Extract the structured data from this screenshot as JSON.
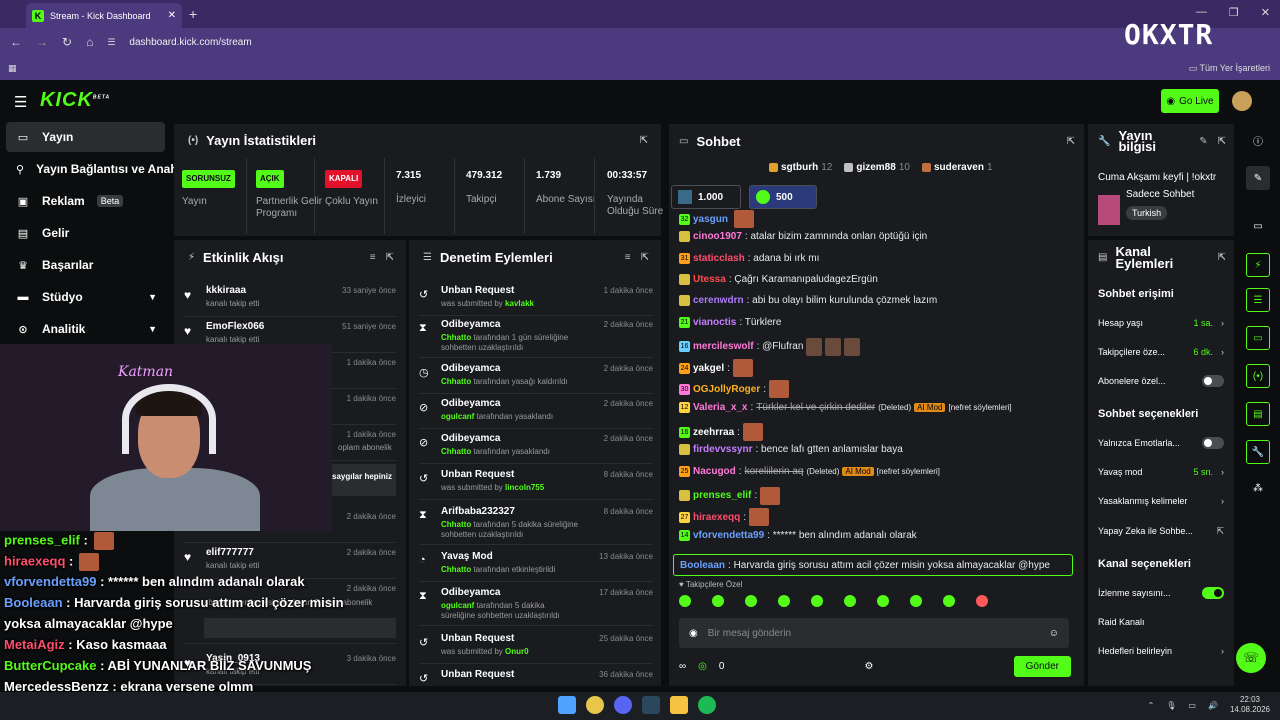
{
  "browser": {
    "tab_title": "Stream - Kick Dashboard",
    "url": "dashboard.kick.com/stream",
    "all_bookmarks": "Tüm Yer İşaretleri",
    "watermark": "OKXTR"
  },
  "header": {
    "logo": "KICK",
    "logo_beta": "BETA",
    "go_live": "Go Live"
  },
  "sidebar": {
    "items": [
      {
        "label": "Yayın",
        "icon": "broadcast-icon"
      },
      {
        "label": "Yayın Bağlantısı ve Anahtar",
        "icon": "link-icon"
      },
      {
        "label": "Reklam",
        "icon": "ad-icon",
        "badge": "Beta"
      },
      {
        "label": "Gelir",
        "icon": "revenue-icon"
      },
      {
        "label": "Başarılar",
        "icon": "trophy-icon"
      },
      {
        "label": "Stüdyo",
        "icon": "studio-icon"
      },
      {
        "label": "Analitik",
        "icon": "analytics-icon"
      }
    ]
  },
  "stats": {
    "title": "Yayın İstatistikleri",
    "cols": [
      {
        "badge": "SORUNSUZ",
        "label": "Yayın"
      },
      {
        "badge": "AÇIK",
        "label": "Partnerlik Gelir Programı"
      },
      {
        "badge": "KAPALI",
        "label": "Çoklu Yayın"
      },
      {
        "value": "7.315",
        "label": "İzleyici"
      },
      {
        "value": "479.312",
        "label": "Takipçi"
      },
      {
        "value": "1.739",
        "label": "Abone Sayısı"
      },
      {
        "value": "00:33:57",
        "label": "Yayında Olduğu Süre"
      }
    ]
  },
  "activity": {
    "title": "Etkinlik Akışı",
    "rows": [
      {
        "name": "kkkiraaa",
        "sub": "kanalı takip etti",
        "time": "33 saniye önce"
      },
      {
        "name": "EmoFlex066",
        "sub": "kanalı takip etti",
        "time": "51 saniye önce"
      },
      {
        "name": "",
        "sub": "",
        "time": "1 dakika önce"
      },
      {
        "name": "",
        "sub": "",
        "time": "1 dakika önce"
      },
      {
        "name": "",
        "sub": "oplam abonelik",
        "time": "1 dakika önce"
      },
      {
        "name": "saygılar hepiniz",
        "sub": "",
        "time": ""
      },
      {
        "name": "",
        "sub": "",
        "time": "2 dakika önce"
      },
      {
        "name": "elif777777",
        "sub": "kanalı takip etti",
        "time": "2 dakika önce"
      },
      {
        "name": "",
        "sub": "abonelik yenilemesini kutluyor! Toplam abonelik",
        "time": "2 dakika önce"
      },
      {
        "name": "Yasin_0913",
        "sub": "kanalı takip etti",
        "time": "3 dakika önce"
      }
    ]
  },
  "moderation": {
    "title": "Denetim Eylemleri",
    "rows": [
      {
        "icon": "history-icon",
        "name": "Unban Request",
        "pre": "was submitted by",
        "user": "kavlakk",
        "post": "",
        "time": "1 dakika önce"
      },
      {
        "icon": "hourglass-icon",
        "name": "Odibeyamca",
        "pre": "",
        "user": "Chhatto",
        "post": "tarafından 1 gün süreliğine sohbetten uzaklaştırıldı",
        "time": "2 dakika önce"
      },
      {
        "icon": "clock-icon",
        "name": "Odibeyamca",
        "pre": "",
        "user": "Chhatto",
        "post": "tarafından yasağı kaldırıldı",
        "time": "2 dakika önce"
      },
      {
        "icon": "ban-icon",
        "name": "Odibeyamca",
        "pre": "",
        "user": "ogulcanf",
        "post": "tarafından yasaklandı",
        "time": "2 dakika önce"
      },
      {
        "icon": "ban-icon",
        "name": "Odibeyamca",
        "pre": "",
        "user": "Chhatto",
        "post": "tarafından yasaklandı",
        "time": "2 dakika önce"
      },
      {
        "icon": "history-icon",
        "name": "Unban Request",
        "pre": "was submitted by",
        "user": "lincoln755",
        "post": "",
        "time": "8 dakika önce"
      },
      {
        "icon": "hourglass-icon",
        "name": "Arifbaba232327",
        "pre": "",
        "user": "Chhatto",
        "post": "tarafından 5 dakika süreliğine sohbetten uzaklaştırıldı",
        "time": "8 dakika önce"
      },
      {
        "icon": "slow-mode-icon",
        "name": "Yavaş Mod",
        "pre": "",
        "user": "Chhatto",
        "post": "tarafından etkinleştirildi",
        "time": "13 dakika önce"
      },
      {
        "icon": "hourglass-icon",
        "name": "Odibeyamca",
        "pre": "",
        "user": "ogulcanf",
        "post": "tarafından 5 dakika süreliğine sohbetten uzaklaştırıldı",
        "time": "17 dakika önce"
      },
      {
        "icon": "history-icon",
        "name": "Unban Request",
        "pre": "was submitted by",
        "user": "Onur0",
        "post": "",
        "time": "25 dakika önce"
      },
      {
        "icon": "history-icon",
        "name": "Unban Request",
        "pre": "",
        "user": "",
        "post": "",
        "time": "36 dakika önce"
      }
    ]
  },
  "chat": {
    "title": "Sohbet",
    "gifters": [
      {
        "name": "sgtburh",
        "count": "12",
        "color": "#e0a030"
      },
      {
        "name": "gizem88",
        "count": "10",
        "color": "#c0c0c0"
      },
      {
        "name": "suderaven",
        "count": "1",
        "color": "#c07040"
      }
    ],
    "pills": [
      "1.000",
      "500"
    ],
    "messages": [
      {
        "badge": "32",
        "user": "yasgun",
        "ucolor": "#6aa0ff",
        "text": "",
        "emote": true
      },
      {
        "badge": "",
        "user": "cinoo1907",
        "ucolor": "#ff7ad9",
        "text": ": atalar bizim zamnında onları öptüğü için"
      },
      {
        "badge": "31",
        "user": "staticclash",
        "ucolor": "#ff4d6d",
        "text": ": adana bi ırk mı"
      },
      {
        "badge": "",
        "user": "Utessa",
        "ucolor": "#ff4d4d",
        "text": ": Çağrı KaramanıpaludagezErgün"
      },
      {
        "badge": "",
        "user": "cerenwdrn",
        "ucolor": "#b07aff",
        "text": ": abi bu olayı bilim kurulunda çözmek lazım"
      },
      {
        "badge": "21",
        "user": "vianoctis",
        "ucolor": "#c77dff",
        "text": ": Türklere"
      },
      {
        "badge": "16",
        "user": "mercileswolf",
        "ucolor": "#ff7ad9",
        "text": ": @Flufran",
        "emote3": true
      },
      {
        "badge": "24",
        "user": "yakgel",
        "ucolor": "#fff",
        "text": ":",
        "emote": true
      },
      {
        "badge": "30",
        "user": "OGJollyRoger",
        "ucolor": "#ffb020",
        "text": ":",
        "emote": true
      },
      {
        "badge": "12",
        "user": "Valeria_x_x",
        "ucolor": "#ff7ad9",
        "deleted": "Türkler kel ve çirkin dediler",
        "tag1": "(Deleted)",
        "tag2": "AI Mod",
        "tag3": "[nefret söylemleri]"
      },
      {
        "badge": "16",
        "user": "zeehrraa",
        "ucolor": "#fff",
        "text": ":",
        "emote": true
      },
      {
        "badge": "",
        "user": "firdevvssynr",
        "ucolor": "#c77dff",
        "text": ": bence lafı gtten anlamıslar baya"
      },
      {
        "badge": "25",
        "user": "Nacugod",
        "ucolor": "#ff7ad9",
        "deleted": "koreliilerin aq",
        "tag1": "(Deleted)",
        "tag2": "AI Mod",
        "tag3": "[nefret söylemleri]"
      },
      {
        "badge": "",
        "user": "prenses_elif",
        "ucolor": "#53fc18",
        "text": ":",
        "emote": true
      },
      {
        "badge": "27",
        "user": "hiraexeqq",
        "ucolor": "#ff4d6d",
        "text": ":",
        "emote": true
      },
      {
        "badge": "14",
        "user": "vforvendetta99",
        "ucolor": "#6aa0ff",
        "text": ": ****** ben alındım adanalı olarak"
      }
    ],
    "pinned_user": "Booleaan",
    "pinned_text": ": Harvarda giriş sorusu attım acil çözer misin yoksa almayacaklar @hype",
    "follower_only": "Takipçilere Özel",
    "placeholder": "Bir mesaj gönderin",
    "points": "0",
    "send": "Gönder"
  },
  "stream_info": {
    "title": "Yayın bilgisi",
    "stream_title": "Cuma Akşamı keyfi | !okxtr",
    "category": "Sadece Sohbet",
    "language": "Turkish"
  },
  "channel_actions": {
    "title": "Kanal Eylemleri",
    "chat_access": "Sohbet erişimi",
    "account_age": {
      "label": "Hesap yaşı",
      "value": "1 sa."
    },
    "followers_only": {
      "label": "Takipçilere öze...",
      "value": "6 dk."
    },
    "subs_only": {
      "label": "Abonelere özel..."
    },
    "chat_options": "Sohbet seçenekleri",
    "emotes_only": {
      "label": "Yalnızca Emotlarla..."
    },
    "slow_mode": {
      "label": "Yavaş mod",
      "value": "5 sn."
    },
    "banned_words": {
      "label": "Yasaklanmış kelimeler"
    },
    "ai_chat": {
      "label": "Yapay Zeka ile Sohbe..."
    },
    "channel_options": "Kanal seçenekleri",
    "view_count": {
      "label": "İzlenme sayısını..."
    },
    "raid": {
      "label": "Raid Kanalı"
    },
    "targets": {
      "label": "Hedefleri belirleyin"
    }
  },
  "overlay": {
    "stream_neon": "Katman",
    "lines": [
      {
        "user": "prenses_elif",
        "color": "#53fc18",
        "text": " :",
        "emote": true
      },
      {
        "user": "hiraexeqq",
        "color": "#ff4d6d",
        "text": " :",
        "emote": true
      },
      {
        "user": "vforvendetta99",
        "color": "#6aa0ff",
        "text": " : ****** ben alındım adanalı olarak"
      },
      {
        "user": "Booleaan",
        "color": "#6aa0ff",
        "text": " : Harvarda giriş sorusu attım acil çözer misin"
      },
      {
        "user": "",
        "color": "#fff",
        "text": "yoksa almayacaklar @hype"
      },
      {
        "user": "MetaiAgiz",
        "color": "#ff4d6d",
        "text": " : Kaso kasmaaa"
      },
      {
        "user": "ButterCupcake",
        "color": "#53fc18",
        "text": " : ABİ YUNANLAR BİİZ SAVUNMUŞ"
      },
      {
        "user": "MercedessBenzz",
        "color": "#fff",
        "text": " : ekrana versene olmm"
      }
    ]
  },
  "taskbar": {
    "time": "22:03",
    "date": "14.08.2026"
  },
  "colors": {
    "accent": "#53fc18",
    "panel": "#191b1f",
    "background": "#0b0d0e",
    "browser": "#4b3a7e"
  }
}
